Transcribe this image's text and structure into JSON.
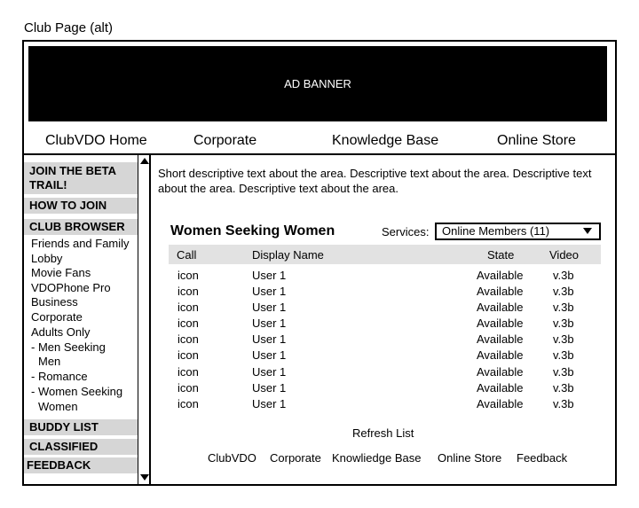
{
  "caption": "Club Page (alt)",
  "banner": "AD BANNER",
  "topnav": [
    "ClubVDO Home",
    "Corporate",
    "Knowledge Base",
    "Online Store"
  ],
  "sidebar": {
    "join_beta": [
      "JOIN THE BETA",
      "TRAIL!"
    ],
    "how_to_join": "HOW TO JOIN",
    "club_browser": "CLUB BROWSER",
    "items": [
      "Friends and Family",
      "Lobby",
      "Movie Fans",
      "VDOPhone Pro",
      "Business",
      "Corporate",
      "Adults Only",
      "- Men Seeking",
      "Men",
      "- Romance",
      "- Women Seeking",
      "Women"
    ],
    "buddy_list": "BUDDY LIST",
    "classified": "CLASSIFIED",
    "feedback": "FEEDBACK"
  },
  "description": "Short descriptive text about the area. Descriptive text about the area. Descriptive text about the area. Descriptive text about the area.",
  "list": {
    "title": "Women Seeking Women",
    "services_label": "Services:",
    "services_value": "Online Members (11)",
    "columns": [
      "Call",
      "Display Name",
      "State",
      "Video"
    ],
    "rows": [
      [
        "icon",
        "User 1",
        "Available",
        "v.3b"
      ],
      [
        "icon",
        "User 1",
        "Available",
        "v.3b"
      ],
      [
        "icon",
        "User 1",
        "Available",
        "v.3b"
      ],
      [
        "icon",
        "User 1",
        "Available",
        "v.3b"
      ],
      [
        "icon",
        "User 1",
        "Available",
        "v.3b"
      ],
      [
        "icon",
        "User 1",
        "Available",
        "v.3b"
      ],
      [
        "icon",
        "User 1",
        "Available",
        "v.3b"
      ],
      [
        "icon",
        "User 1",
        "Available",
        "v.3b"
      ],
      [
        "icon",
        "User 1",
        "Available",
        "v.3b"
      ]
    ],
    "refresh": "Refresh List"
  },
  "footer": [
    "ClubVDO",
    "Corporate",
    "Knowliedge Base",
    "Online Store",
    "Feedback"
  ]
}
